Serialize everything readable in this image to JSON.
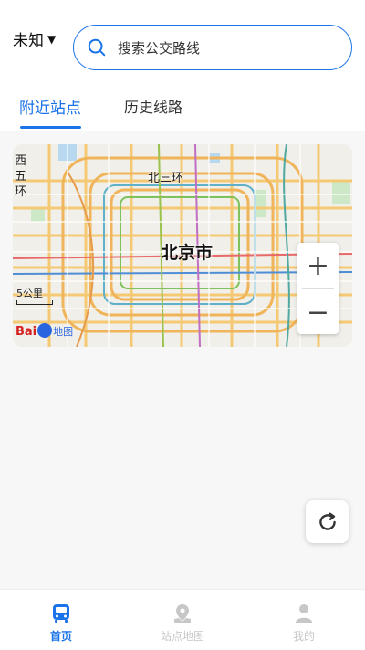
{
  "header": {
    "city": "未知",
    "search_placeholder": "搜索公交路线"
  },
  "tabs": [
    {
      "label": "附近站点",
      "active": true
    },
    {
      "label": "历史线路",
      "active": false
    }
  ],
  "map": {
    "city_label": "北京市",
    "ring_label": "北三环",
    "side_label": "西五环",
    "scale_label": "5公里",
    "logo_text_a": "Bai",
    "logo_text_b": "地图",
    "zoom_in": "+",
    "zoom_out": "−"
  },
  "bottom_nav": [
    {
      "label": "首页",
      "icon": "bus-icon",
      "active": true
    },
    {
      "label": "站点地图",
      "icon": "map-pin-icon",
      "active": false
    },
    {
      "label": "我的",
      "icon": "user-icon",
      "active": false
    }
  ],
  "colors": {
    "accent": "#1a73e8",
    "inactive": "#c7c7c7",
    "background": "#f7f7f7"
  }
}
